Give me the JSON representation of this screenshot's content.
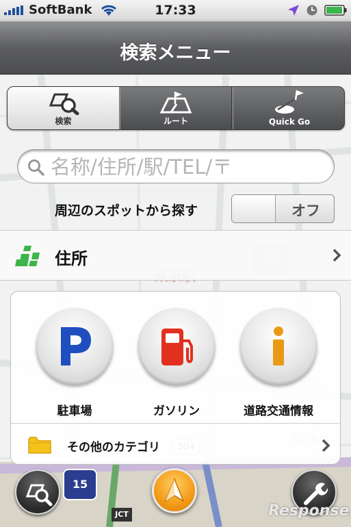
{
  "status_bar": {
    "carrier": "SoftBank",
    "time": "17:33"
  },
  "nav": {
    "title": "検索メニュー"
  },
  "segments": [
    {
      "label": "検索",
      "icon": "search-map-icon",
      "active": true
    },
    {
      "label": "ルート",
      "icon": "route-flag-icon",
      "active": false
    },
    {
      "label": "Quick Go",
      "icon": "quick-go-flag-icon",
      "active": false
    }
  ],
  "search": {
    "placeholder": "名称/住所/駅/TEL/〒"
  },
  "nearby": {
    "label": "周辺のスポットから探す",
    "toggle_state": "オフ"
  },
  "address": {
    "label": "住所"
  },
  "categories": [
    {
      "label": "駐車場",
      "icon": "parking-icon"
    },
    {
      "label": "ガソリン",
      "icon": "gas-pump-icon"
    },
    {
      "label": "道路交通情報",
      "icon": "info-icon"
    }
  ],
  "other_category": {
    "label": "その他のカテゴリ"
  },
  "map_labels": {
    "station": "東京駅",
    "route_10": "10",
    "route_304": "304",
    "route_15": "15",
    "distance": "500m",
    "jct": "JCT"
  },
  "watermark": "Response.",
  "colors": {
    "accent_orange": "#f39a17",
    "address_green": "#3cb44a",
    "parking_blue": "#1f4fbf",
    "gas_red": "#e2301f",
    "info_yellow": "#e99a14"
  }
}
